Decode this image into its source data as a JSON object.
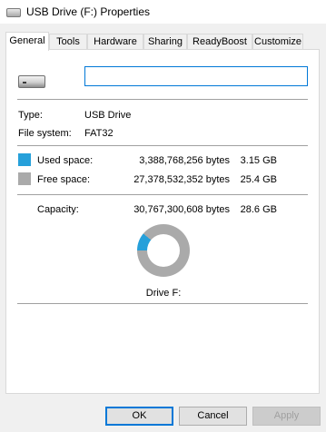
{
  "window": {
    "title": "USB Drive (F:) Properties",
    "icon": "usb-drive-icon"
  },
  "tabs": [
    {
      "label": "General",
      "active": true
    },
    {
      "label": "Tools"
    },
    {
      "label": "Hardware"
    },
    {
      "label": "Sharing"
    },
    {
      "label": "ReadyBoost"
    },
    {
      "label": "Customize"
    }
  ],
  "general": {
    "drive_icon": "usb-drive-icon",
    "name_value": "",
    "type_label": "Type:",
    "type_value": "USB Drive",
    "fs_label": "File system:",
    "fs_value": "FAT32",
    "used": {
      "label": "Used space:",
      "bytes": "3,388,768,256 bytes",
      "gb": "3.15 GB",
      "color": "#26a0da"
    },
    "free": {
      "label": "Free space:",
      "bytes": "27,378,532,352 bytes",
      "gb": "25.4 GB",
      "color": "#aaaaaa"
    },
    "capacity": {
      "label": "Capacity:",
      "bytes": "30,767,300,608 bytes",
      "gb": "28.6 GB"
    },
    "used_fraction": 0.11,
    "drive_label": "Drive F:"
  },
  "buttons": {
    "ok": "OK",
    "cancel": "Cancel",
    "apply": "Apply"
  }
}
